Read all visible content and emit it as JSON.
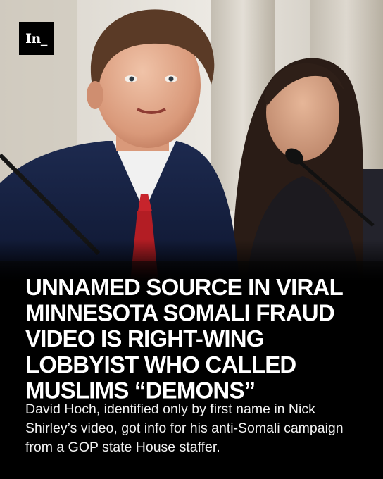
{
  "brand": {
    "logo_text": "In_"
  },
  "article": {
    "headline": "UNNAMED SOURCE IN VIRAL MINNESOTA SOMALI FRAUD VIDEO IS RIGHT-WING LOBBYIST WHO CALLED MUSLIMS “DEMONS”",
    "subhead": "David Hoch, identified only by first name in Nick Shirley’s video, got info for his anti-Somali campaign from a GOP state House staffer."
  },
  "colors": {
    "background": "#000000",
    "text": "#ffffff"
  }
}
